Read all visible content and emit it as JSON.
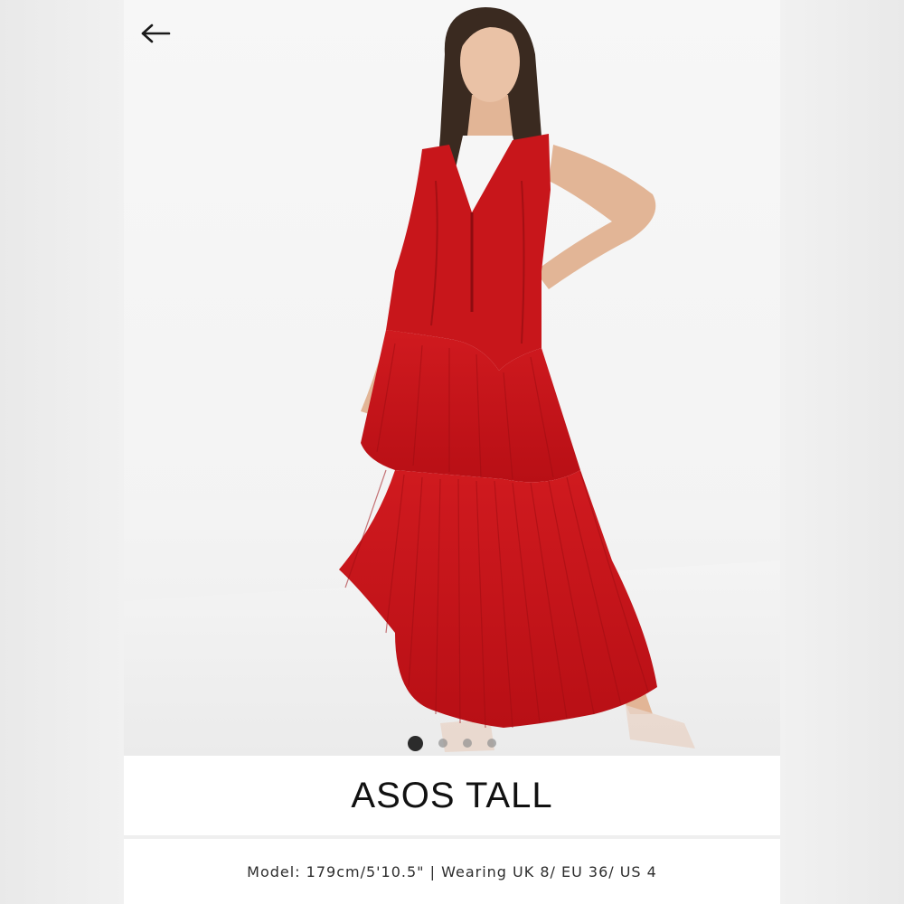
{
  "navigation": {
    "back_icon": "arrow-left-icon"
  },
  "gallery": {
    "image_alt": "Red fringe maxi dress",
    "slide_count": 4,
    "active_slide": 1
  },
  "product": {
    "brand": "ASOS TALL",
    "model_info": "Model: 179cm/5'10.5\" | Wearing UK 8/ EU 36/ US 4"
  },
  "colors": {
    "dress": "#c8161b",
    "active_dot": "#2b2b2b",
    "inactive_dot": "#8f8f8f"
  }
}
